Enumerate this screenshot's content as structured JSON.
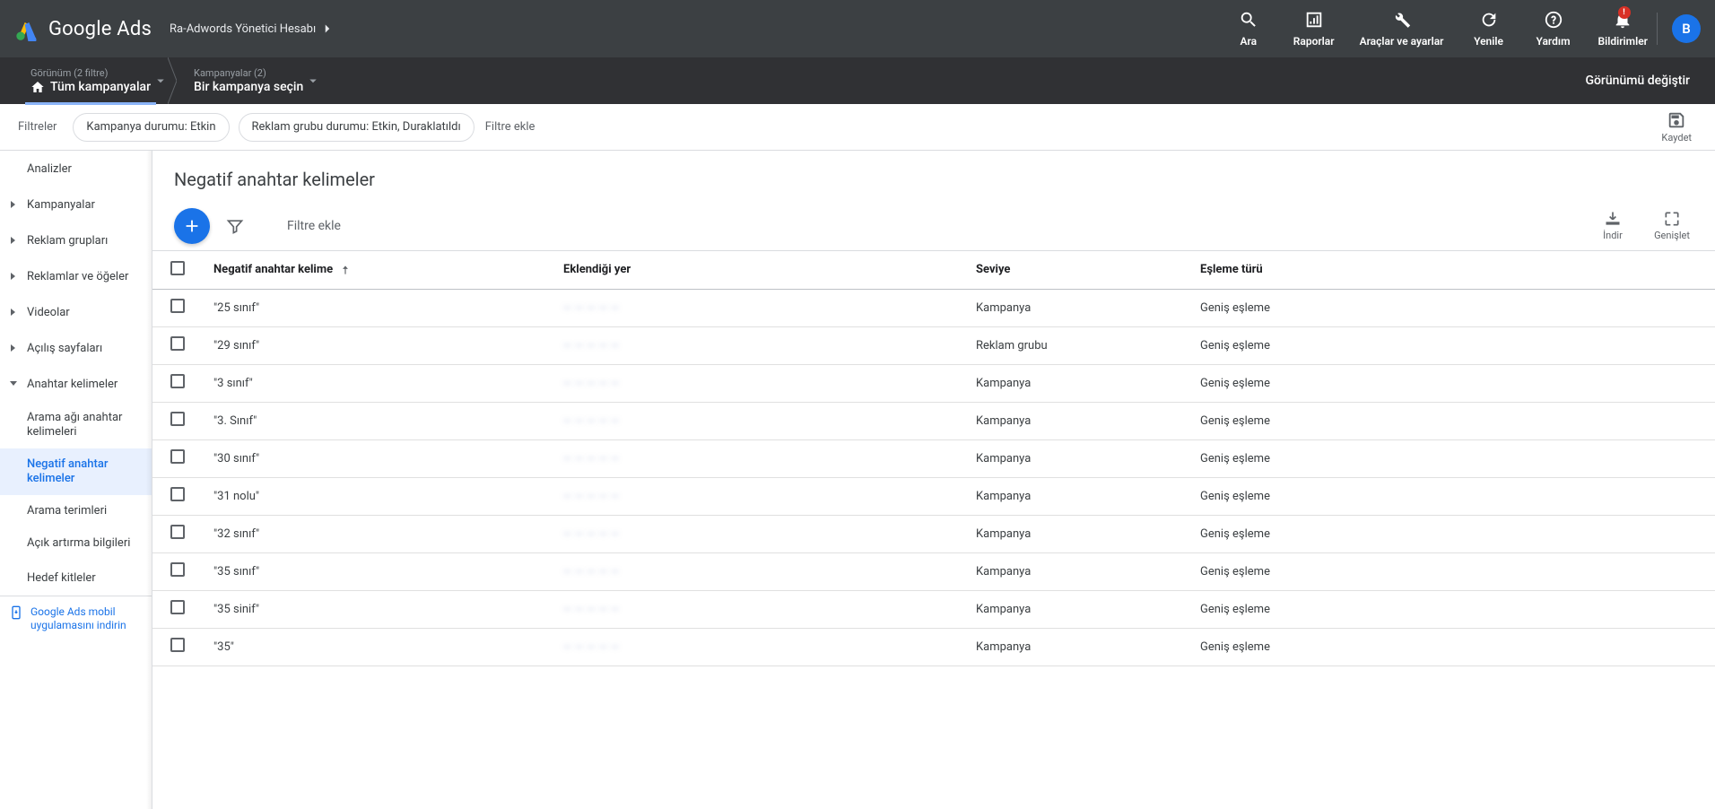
{
  "brand": {
    "name": "Google Ads"
  },
  "account": {
    "label": "Ra-Adwords Yönetici Hesabı"
  },
  "headerActions": {
    "search": "Ara",
    "reports": "Raporlar",
    "tools": "Araçlar ve ayarlar",
    "refresh": "Yenile",
    "help": "Yardım",
    "notifications": "Bildirimler",
    "notificationBadge": "!"
  },
  "avatarInitial": "B",
  "breadcrumb": {
    "view": {
      "top": "Görünüm (2 filtre)",
      "bottom": "Tüm kampanyalar"
    },
    "campaign": {
      "top": "Kampanyalar (2)",
      "bottom": "Bir kampanya seçin"
    },
    "changeView": "Görünümü değiştir"
  },
  "filterBar": {
    "label": "Filtreler",
    "chips": [
      "Kampanya durumu: Etkin",
      "Reklam grubu durumu: Etkin, Duraklatıldı"
    ],
    "add": "Filtre ekle",
    "save": "Kaydet"
  },
  "sidebar": {
    "items": [
      {
        "label": "Analizler",
        "expandable": false
      },
      {
        "label": "Kampanyalar",
        "expandable": true
      },
      {
        "label": "Reklam grupları",
        "expandable": true
      },
      {
        "label": "Reklamlar ve öğeler",
        "expandable": true
      },
      {
        "label": "Videolar",
        "expandable": true
      },
      {
        "label": "Açılış sayfaları",
        "expandable": true
      },
      {
        "label": "Anahtar kelimeler",
        "expandable": true,
        "open": true,
        "children": [
          {
            "label": "Arama ağı anahtar kelimeleri"
          },
          {
            "label": "Negatif anahtar kelimeler",
            "active": true
          },
          {
            "label": "Arama terimleri"
          },
          {
            "label": "Açık artırma bilgileri"
          }
        ]
      },
      {
        "label": "Hedef kitleler",
        "expandable": false
      }
    ],
    "mobilePromo": "Google Ads mobil uygulamasını indirin"
  },
  "page": {
    "title": "Negatif anahtar kelimeler",
    "toolbar": {
      "addFilter": "Filtre ekle",
      "download": "İndir",
      "expand": "Genişlet"
    },
    "table": {
      "headers": {
        "keyword": "Negatif anahtar kelime",
        "addedTo": "Eklendiği yer",
        "level": "Seviye",
        "matchType": "Eşleme türü"
      },
      "rows": [
        {
          "kw": "\"25 sınıf\"",
          "level": "Kampanya",
          "match": "Geniş eşleme"
        },
        {
          "kw": "\"29 sınıf\"",
          "level": "Reklam grubu",
          "match": "Geniş eşleme"
        },
        {
          "kw": "\"3 sınıf\"",
          "level": "Kampanya",
          "match": "Geniş eşleme"
        },
        {
          "kw": "\"3. Sınıf\"",
          "level": "Kampanya",
          "match": "Geniş eşleme"
        },
        {
          "kw": "\"30 sınıf\"",
          "level": "Kampanya",
          "match": "Geniş eşleme"
        },
        {
          "kw": "\"31 nolu\"",
          "level": "Kampanya",
          "match": "Geniş eşleme"
        },
        {
          "kw": "\"32 sınıf\"",
          "level": "Kampanya",
          "match": "Geniş eşleme"
        },
        {
          "kw": "\"35 sınıf\"",
          "level": "Kampanya",
          "match": "Geniş eşleme"
        },
        {
          "kw": "\"35 sinif\"",
          "level": "Kampanya",
          "match": "Geniş eşleme"
        },
        {
          "kw": "\"35\"",
          "level": "Kampanya",
          "match": "Geniş eşleme"
        }
      ]
    }
  }
}
